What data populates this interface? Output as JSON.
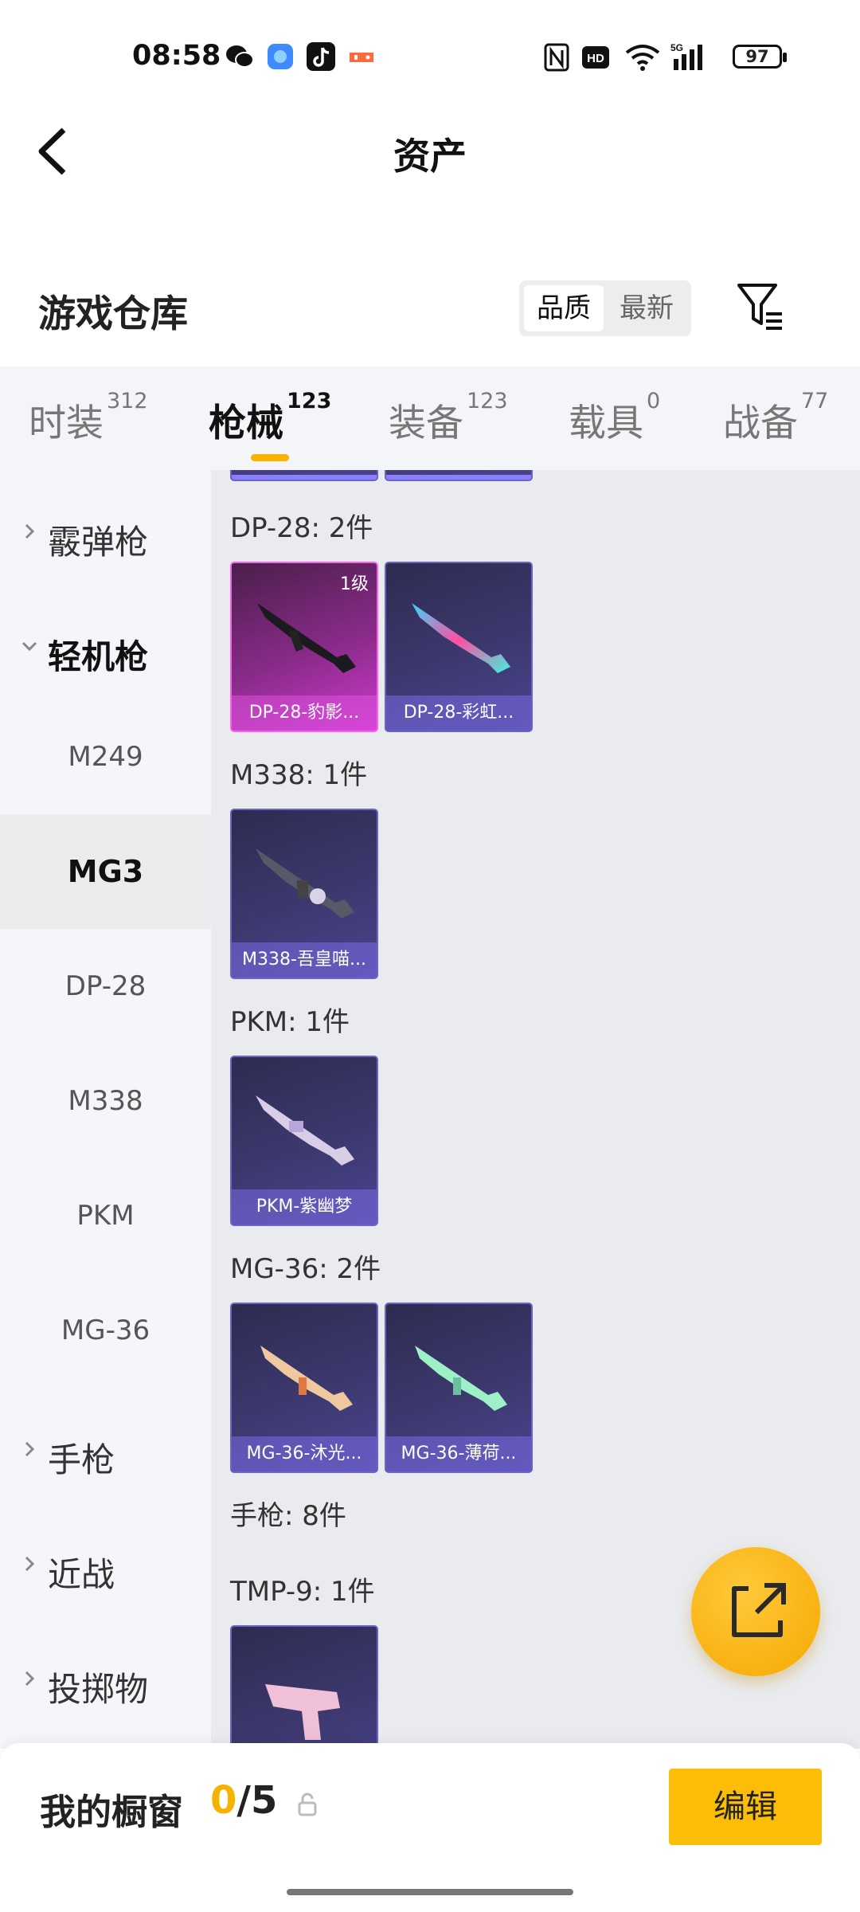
{
  "status_bar": {
    "time": "08:58",
    "battery": "97",
    "network": "5G",
    "icons": [
      "wechat-icon",
      "browser-icon",
      "tiktok-icon",
      "game-icon",
      "nfc-icon",
      "hd-icon",
      "wifi-icon",
      "signal-icon"
    ]
  },
  "header": {
    "title": "资产",
    "back_icon": "chevron-left-icon"
  },
  "warehouse": {
    "title": "游戏仓库",
    "sort_options": [
      "品质",
      "最新"
    ],
    "sort_selected": "品质",
    "filter_icon": "filter-icon"
  },
  "tabs": [
    {
      "label": "时装",
      "count": "312"
    },
    {
      "label": "枪械",
      "count": "123",
      "active": true
    },
    {
      "label": "装备",
      "count": "123"
    },
    {
      "label": "载具",
      "count": "0"
    },
    {
      "label": "战备",
      "count": "77"
    }
  ],
  "sidebar": {
    "groups": {
      "shotgun": "霰弹枪",
      "lmg": "轻机枪",
      "pistol": "手枪",
      "melee": "近战",
      "throwable": "投掷物"
    },
    "lmg_items": [
      "M249",
      "MG3",
      "DP-28",
      "M338",
      "PKM",
      "MG-36"
    ],
    "selected": "MG3"
  },
  "content": {
    "sections": [
      {
        "label": "DP-28: 2件",
        "items": [
          {
            "name": "DP-28-豹影...",
            "level": "1级",
            "rarity": "legendary"
          },
          {
            "name": "DP-28-彩虹..."
          }
        ]
      },
      {
        "label": "M338: 1件",
        "items": [
          {
            "name": "M338-吾皇喵..."
          }
        ]
      },
      {
        "label": "PKM: 1件",
        "items": [
          {
            "name": "PKM-紫幽梦"
          }
        ]
      },
      {
        "label": "MG-36: 2件",
        "items": [
          {
            "name": "MG-36-沐光..."
          },
          {
            "name": "MG-36-薄荷..."
          }
        ]
      }
    ],
    "category_pistol": "手枪: 8件",
    "tmp_label": "TMP-9: 1件"
  },
  "fab": {
    "icon": "share-icon"
  },
  "bottom_bar": {
    "label": "我的橱窗",
    "count_current": "0",
    "count_total": "/5",
    "edit_label": "编辑"
  },
  "colors": {
    "accent": "#f7b500",
    "card_purple": "#3e3a72",
    "card_pink": "#cf3ad0"
  }
}
